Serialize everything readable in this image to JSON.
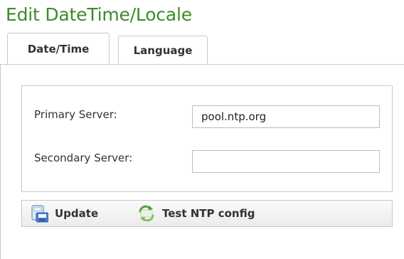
{
  "page": {
    "title": "Edit DateTime/Locale"
  },
  "tabs": [
    {
      "label": "Date/Time"
    },
    {
      "label": "Language"
    }
  ],
  "form": {
    "primary_label": "Primary Server:",
    "primary_value": "pool.ntp.org",
    "secondary_label": "Secondary Server:",
    "secondary_value": ""
  },
  "toolbar": {
    "update_label": "Update",
    "update_icon": "save-disk-icon",
    "test_label": "Test NTP config",
    "test_icon": "refresh-arrows-icon"
  },
  "colors": {
    "title_green": "#3e8a2c",
    "border_gray": "#c9c9c9"
  }
}
